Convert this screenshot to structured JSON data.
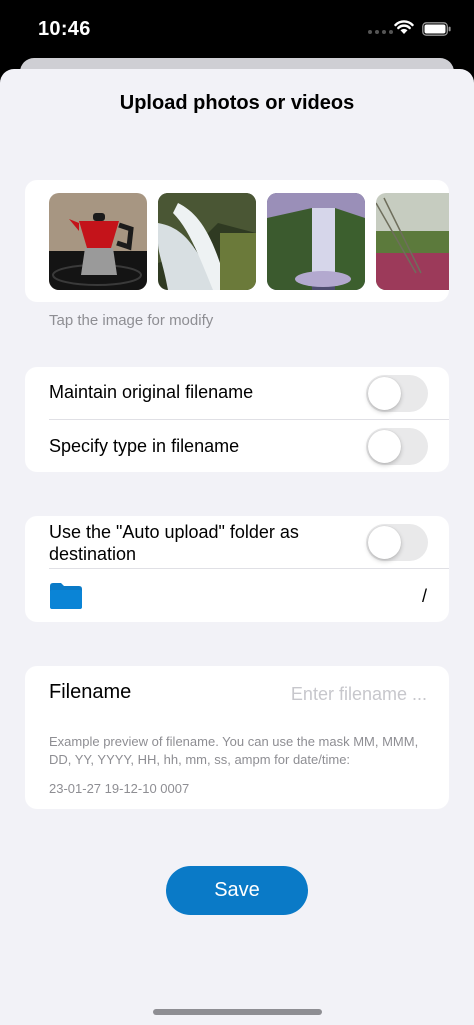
{
  "status_bar": {
    "time": "10:46"
  },
  "sheet": {
    "title": "Upload photos or videos"
  },
  "photos": {
    "hint": "Tap the image for modify",
    "items": [
      {
        "subject": "moka pot"
      },
      {
        "subject": "waterfall"
      },
      {
        "subject": "waterfall"
      },
      {
        "subject": "grass"
      }
    ]
  },
  "options": {
    "maintain_filename": {
      "label": "Maintain original filename",
      "on": false
    },
    "type_in_filename": {
      "label": "Specify type in filename",
      "on": false
    }
  },
  "destination": {
    "auto_upload_label": "Use the \"Auto upload\" folder as destination",
    "auto_upload_on": false,
    "path": "/"
  },
  "filename": {
    "label": "Filename",
    "placeholder": "Enter filename ...",
    "value": "",
    "help": "Example preview of filename. You can use the mask MM, MMM, DD, YY, YYYY, HH, hh, mm, ss, ampm for date/time:",
    "preview": "23-01-27 19-12-10 0007"
  },
  "save_label": "Save",
  "colors": {
    "accent": "#0a7ac7",
    "background": "#f2f2f7",
    "secondary_text": "#8e8e93"
  }
}
